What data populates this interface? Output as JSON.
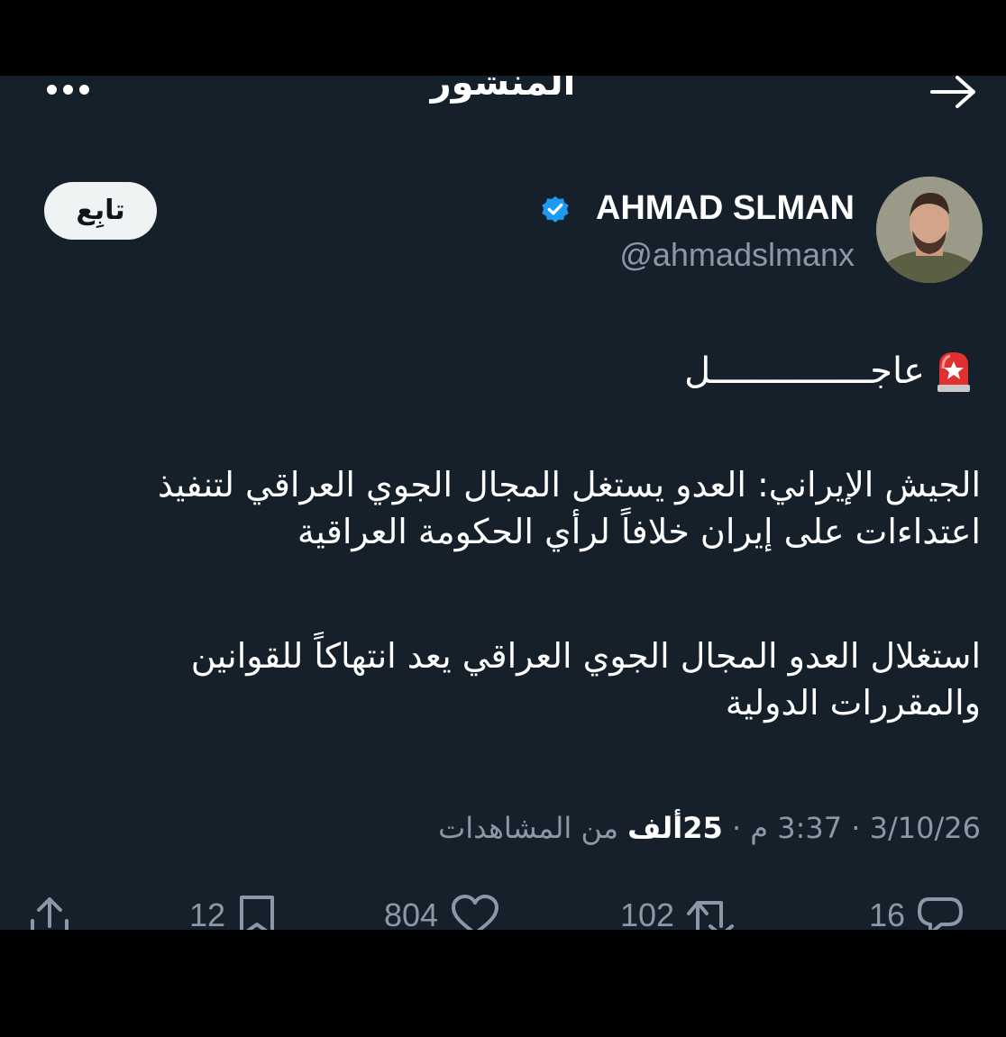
{
  "header": {
    "title": "المنشور"
  },
  "author": {
    "name": "AHMAD SLMAN",
    "handle": "@ahmadslmanx",
    "verified": true
  },
  "follow_button": {
    "label": "تابِع"
  },
  "post": {
    "urgent_label": "عاجـــــــــــــــل",
    "paragraph1": "الجيش الإيراني: العدو يستغل المجال الجوي العراقي لتنفيذ\nاعتداءات على إيران خلافاً لرأي الحكومة العراقية",
    "paragraph2": "استغلال العدو المجال الجوي العراقي يعد انتهاكاً للقوانين\nوالمقررات الدولية"
  },
  "meta": {
    "date": "3/10/26",
    "separator": "·",
    "time": "3:37 م",
    "views_count": "25ألف",
    "views_label": "من المشاهدات"
  },
  "actions": {
    "replies": "16",
    "reposts": "102",
    "likes": "804",
    "bookmarks": "12"
  },
  "colors": {
    "background": "#15202b",
    "muted_text": "#8b98a5",
    "verified": "#1d9bf0",
    "follow_bg": "#eff3f4"
  }
}
